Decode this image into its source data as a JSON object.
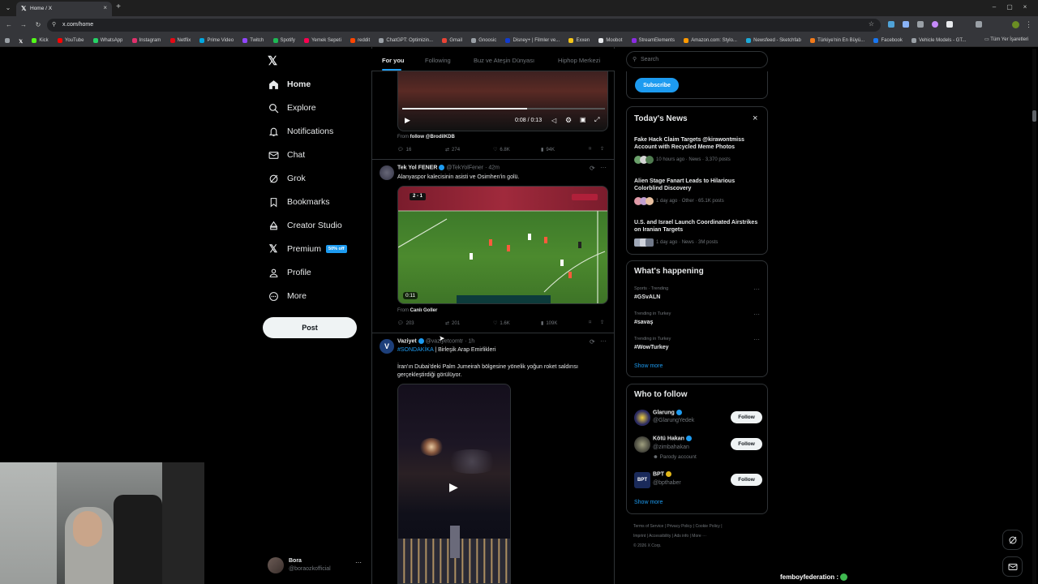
{
  "browser": {
    "tab_title": "Home / X",
    "url": "x.com/home",
    "bookmarks": [
      "Kick",
      "YouTube",
      "WhatsApp",
      "Instagram",
      "Netflix",
      "Prime Video",
      "Twitch",
      "Spotify",
      "Yemek Sepeti",
      "reddit",
      "ChatGPT: Optimizin...",
      "Gmail",
      "Gnoosic",
      "Disney+ | Filmler ve...",
      "Exxen",
      "Moobot",
      "StreamElements",
      "Amazon.com: Stylo...",
      "Newsfeed - Sketchfab",
      "Türkiye'nin En Büyü...",
      "Facebook",
      "Vehicle Models - GT..."
    ],
    "all_bookmarks": "Tüm Yer İşaretleri"
  },
  "nav": {
    "home": "Home",
    "explore": "Explore",
    "notifications": "Notifications",
    "chat": "Chat",
    "grok": "Grok",
    "bookmarks": "Bookmarks",
    "creator_studio": "Creator Studio",
    "premium": "Premium",
    "premium_badge": "50% off",
    "profile": "Profile",
    "more": "More",
    "post": "Post"
  },
  "account": {
    "name": "Bora",
    "handle": "@boraozkofficial"
  },
  "feed_tabs": [
    "For you",
    "Following",
    "Buz ve Ateşin Dünyası",
    "Hiphop Merkezi"
  ],
  "tweet1": {
    "video_time": "0:08 / 0:13",
    "from_label": "From",
    "from_source": "follow @BrodilKDB",
    "replies": "16",
    "reposts": "274",
    "likes": "6.8K",
    "views": "94K"
  },
  "tweet2": {
    "name": "Tek Yol FENER",
    "handle": "@TekYolFener",
    "time": "42m",
    "text": "Alanyaspor kalecisinin asisti ve Osimhen'in golü.",
    "duration": "0:11",
    "scoreboard": "2 - 1",
    "from_label": "From",
    "from_source": "Canlı Goller",
    "replies": "203",
    "reposts": "201",
    "likes": "1.6K",
    "views": "109K"
  },
  "tweet3": {
    "name": "Vaziyet",
    "handle": "@vaziyetcomtr",
    "time": "1h",
    "hashtag": "#SONDAKİKA",
    "text_line1": "| Birleşik Arap Emirlikleri",
    "text_body": "İran'ın Dubai'deki Palm Jumeirah bölgesine yönelik yoğun roket saldırısı gerçekleştirdiği görülüyor."
  },
  "search": {
    "placeholder": "Search"
  },
  "subscribe": "Subscribe",
  "todays_news": {
    "title": "Today's News",
    "items": [
      {
        "title": "Fake Hack Claim Targets @kirawontmiss Account with Recycled Meme Photos",
        "meta": "10 hours ago · News · 3,370 posts"
      },
      {
        "title": "Alien Stage Fanart Leads to Hilarious Colorblind Discovery",
        "meta": "1 day ago · Other · 65.1K posts"
      },
      {
        "title": "U.S. and Israel Launch Coordinated Airstrikes on Iranian Targets",
        "meta": "1 day ago · News · 3M posts"
      }
    ]
  },
  "whats_happening": {
    "title": "What's happening",
    "items": [
      {
        "meta": "Sports · Trending",
        "name": "#GSvALN"
      },
      {
        "meta": "Trending in Turkey",
        "name": "#savaş"
      },
      {
        "meta": "Trending in Turkey",
        "name": "#WowTurkey"
      }
    ],
    "show_more": "Show more"
  },
  "who_to_follow": {
    "title": "Who to follow",
    "users": [
      {
        "name": "Glarung",
        "handle": "@GlarungYedek",
        "extra": ""
      },
      {
        "name": "Kötü Hakan",
        "handle": "@zimbahakan",
        "extra": "Parody account"
      },
      {
        "name": "BPT",
        "handle": "@bpthaber",
        "extra": ""
      }
    ],
    "follow": "Follow",
    "show_more": "Show more"
  },
  "footer": {
    "links": [
      "Terms of Service",
      "Privacy Policy",
      "Cookie Policy",
      "Imprint",
      "Accessibility",
      "Ads info",
      "More ···"
    ],
    "copyright": "© 2026 X Corp."
  },
  "overlay_text": "femboyfederation :",
  "colors": {
    "accent": "#1d9bf0",
    "background": "#000000",
    "border": "#2f3336",
    "muted": "#71767b"
  }
}
